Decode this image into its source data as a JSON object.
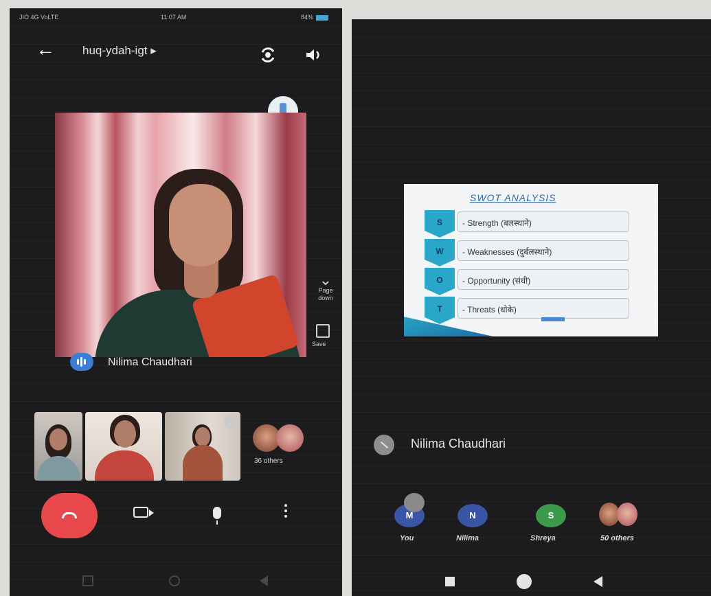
{
  "left_screen": {
    "status": {
      "carrier": "JIO 4G VoLTE",
      "time": "11:07 AM",
      "battery": "84%"
    },
    "meeting_code": "huq-ydah-igt",
    "page_down_label": "Page down",
    "save_label": "Save",
    "active_speaker": "Nilima Chaudhari",
    "others_label": "36 others",
    "icons": [
      "back-arrow-icon",
      "switch-camera-icon",
      "speaker-icon",
      "pin-icon",
      "chevron-down-icon",
      "save-icon",
      "end-call-icon",
      "camera-icon",
      "mic-icon",
      "more-icon"
    ]
  },
  "right_screen": {
    "slide": {
      "title": "SWOT  ANALYSIS",
      "items": [
        {
          "letter": "S",
          "text": "- Strength (बलस्थाने)"
        },
        {
          "letter": "W",
          "text": "- Weaknesses (दुर्बलस्थाने)"
        },
        {
          "letter": "O",
          "text": "- Opportunity (संधी)"
        },
        {
          "letter": "T",
          "text": "- Threats (धोके)"
        }
      ]
    },
    "presenter": "Nilima Chaudhari",
    "participants": [
      {
        "initial": "M",
        "label": "You",
        "color": "#3a55a6"
      },
      {
        "initial": "N",
        "label": "Nilima",
        "color": "#3a55a6"
      },
      {
        "initial": "S",
        "label": "Shreya",
        "color": "#3c9a4a"
      }
    ],
    "others_label": "50 others"
  },
  "colors": {
    "end_call": "#e8474b",
    "accent_blue": "#3b7ed6",
    "slide_teal": "#2aa6c8"
  }
}
